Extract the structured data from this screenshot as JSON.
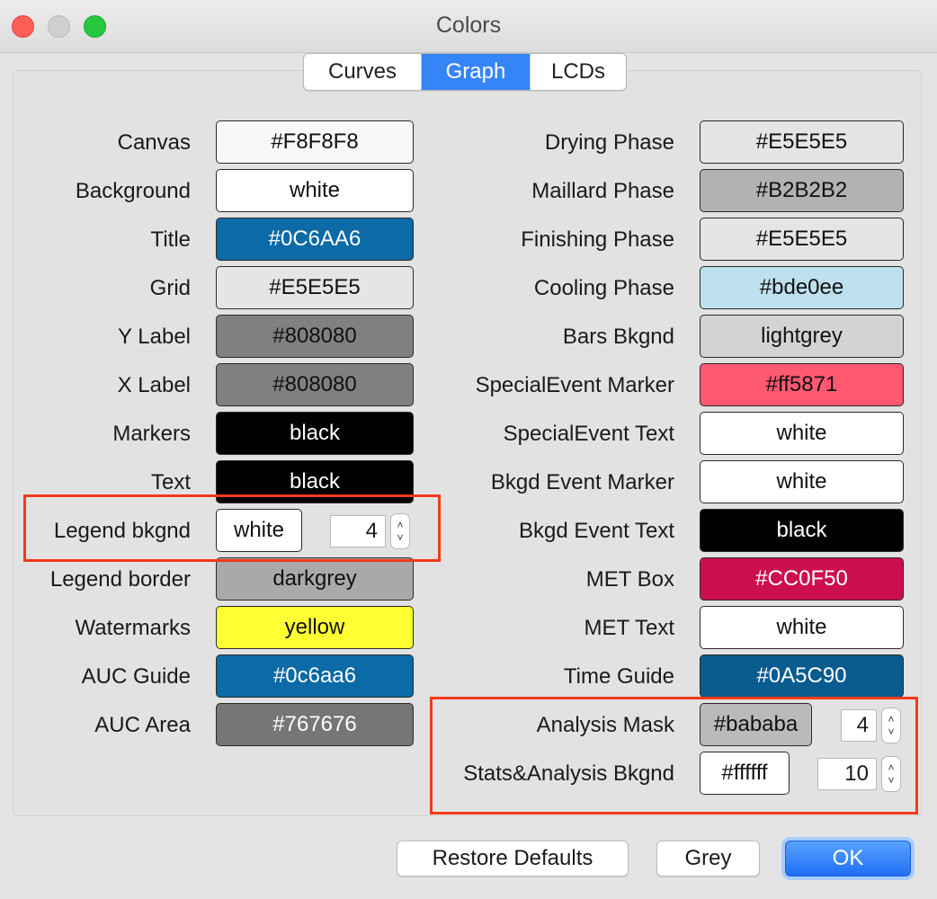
{
  "window": {
    "title": "Colors"
  },
  "tabs": [
    {
      "label": "Curves",
      "active": false
    },
    {
      "label": "Graph",
      "active": true
    },
    {
      "label": "LCDs",
      "active": false
    }
  ],
  "left": [
    {
      "label": "Canvas",
      "value": "#F8F8F8",
      "bg": "#F8F8F8",
      "fg": "#111111"
    },
    {
      "label": "Background",
      "value": "white",
      "bg": "#FFFFFF",
      "fg": "#111111"
    },
    {
      "label": "Title",
      "value": "#0C6AA6",
      "bg": "#0C6AA6",
      "fg": "#FFFFFF"
    },
    {
      "label": "Grid",
      "value": "#E5E5E5",
      "bg": "#E5E5E5",
      "fg": "#111111"
    },
    {
      "label": "Y Label",
      "value": "#808080",
      "bg": "#808080",
      "fg": "#111111"
    },
    {
      "label": "X Label",
      "value": "#808080",
      "bg": "#808080",
      "fg": "#111111"
    },
    {
      "label": "Markers",
      "value": "black",
      "bg": "#000000",
      "fg": "#FFFFFF"
    },
    {
      "label": "Text",
      "value": "black",
      "bg": "#000000",
      "fg": "#FFFFFF"
    },
    {
      "label": "Legend bkgnd",
      "value": "white",
      "bg": "#FFFFFF",
      "fg": "#111111",
      "spin": "4"
    },
    {
      "label": "Legend border",
      "value": "darkgrey",
      "bg": "#A9A9A9",
      "fg": "#111111"
    },
    {
      "label": "Watermarks",
      "value": "yellow",
      "bg": "#FFFF33",
      "fg": "#111111"
    },
    {
      "label": "AUC Guide",
      "value": "#0c6aa6",
      "bg": "#0C6AA6",
      "fg": "#FFFFFF"
    },
    {
      "label": "AUC Area",
      "value": "#767676",
      "bg": "#767676",
      "fg": "#FFFFFF"
    }
  ],
  "right": [
    {
      "label": "Drying Phase",
      "value": "#E5E5E5",
      "bg": "#E5E5E5",
      "fg": "#111111"
    },
    {
      "label": "Maillard Phase",
      "value": "#B2B2B2",
      "bg": "#B2B2B2",
      "fg": "#111111"
    },
    {
      "label": "Finishing Phase",
      "value": "#E5E5E5",
      "bg": "#E5E5E5",
      "fg": "#111111"
    },
    {
      "label": "Cooling Phase",
      "value": "#bde0ee",
      "bg": "#BDE0EE",
      "fg": "#111111"
    },
    {
      "label": "Bars Bkgnd",
      "value": "lightgrey",
      "bg": "#D3D3D3",
      "fg": "#111111"
    },
    {
      "label": "SpecialEvent Marker",
      "value": "#ff5871",
      "bg": "#FF5871",
      "fg": "#111111"
    },
    {
      "label": "SpecialEvent Text",
      "value": "white",
      "bg": "#FFFFFF",
      "fg": "#111111"
    },
    {
      "label": "Bkgd Event Marker",
      "value": "white",
      "bg": "#FFFFFF",
      "fg": "#111111"
    },
    {
      "label": "Bkgd Event Text",
      "value": "black",
      "bg": "#000000",
      "fg": "#FFFFFF"
    },
    {
      "label": "MET Box",
      "value": "#CC0F50",
      "bg": "#CC0F50",
      "fg": "#FFFFFF"
    },
    {
      "label": "MET Text",
      "value": "white",
      "bg": "#FFFFFF",
      "fg": "#111111"
    },
    {
      "label": "Time Guide",
      "value": "#0A5C90",
      "bg": "#0A5C90",
      "fg": "#FFFFFF"
    },
    {
      "label": "Analysis Mask",
      "value": "#bababa",
      "bg": "#BABABA",
      "fg": "#111111",
      "spin": "4"
    },
    {
      "label": "Stats&Analysis Bkgnd",
      "value": "#ffffff",
      "bg": "#FFFFFF",
      "fg": "#111111",
      "spin": "10"
    }
  ],
  "buttons": {
    "restore": "Restore Defaults",
    "grey": "Grey",
    "ok": "OK"
  }
}
